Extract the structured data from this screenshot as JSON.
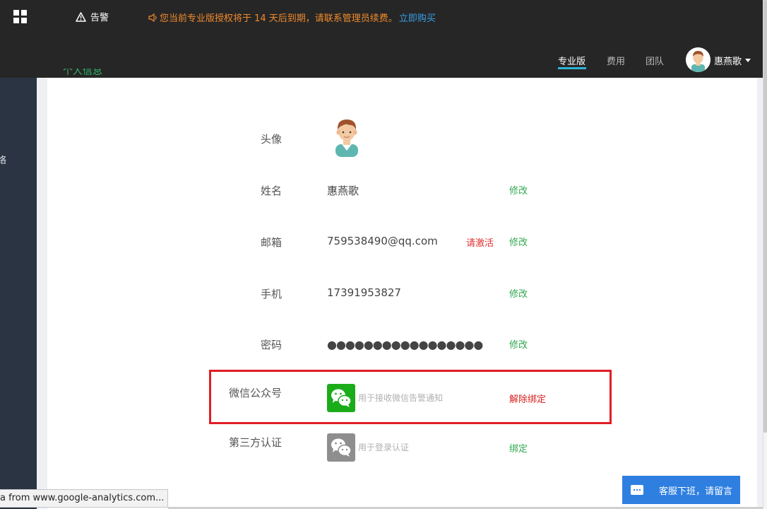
{
  "topbar": {
    "alarm_label": "告警",
    "notice_text": "您当前专业版授权将于 14 天后到期，请联系管理员续费。",
    "notice_link": "立即购买",
    "nav": [
      "专业版",
      "费用",
      "团队"
    ],
    "username": "惠燕歌"
  },
  "sidebar": {
    "partial_text": "络"
  },
  "profile": {
    "section_title": "个人信息",
    "avatar_label": "头像",
    "name_label": "姓名",
    "name_value": "惠燕歌",
    "email_label": "邮箱",
    "email_value": "759538490@qq.com",
    "email_status": "请激活",
    "phone_label": "手机",
    "phone_value": "17391953827",
    "password_label": "密码",
    "password_value": "●●●●●●●●●●●●●●●●●",
    "edit_label": "修改",
    "wechat_label": "微信公众号",
    "wechat_hint": "用于接收微信告警通知",
    "wechat_action": "解除绑定",
    "thirdparty_label": "第三方认证",
    "thirdparty_hint": "用于登录认证",
    "thirdparty_action": "绑定"
  },
  "status_bar": {
    "url_text": "a from www.google-analytics.com..."
  },
  "support": {
    "label": "客服下班，请留言"
  },
  "colors": {
    "accent_green": "#2ea84f",
    "warning_orange": "#f08a2c",
    "danger_red": "#e21d25",
    "wechat_green": "#1aad19",
    "support_blue": "#2f7fe0"
  }
}
